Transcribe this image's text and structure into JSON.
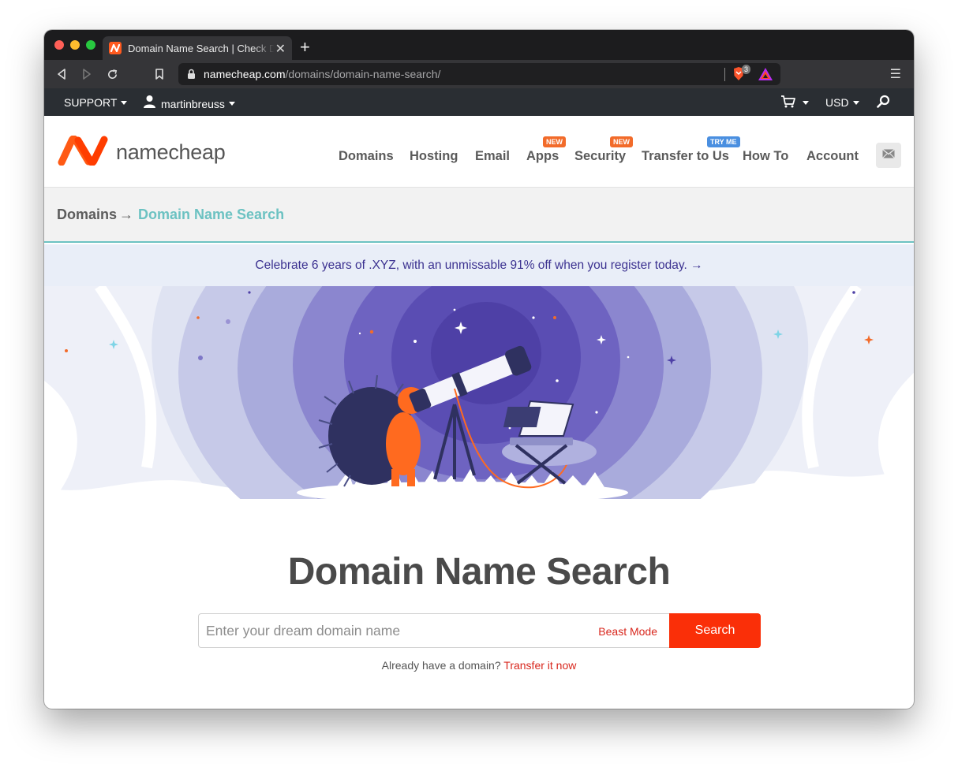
{
  "browser": {
    "tab_title": "Domain Name Search | Check Domain Availability",
    "url_host": "namecheap.com",
    "url_path": "/domains/domain-name-search/",
    "brave_badge_count": "3"
  },
  "sitebar": {
    "support_label": "SUPPORT",
    "username": "martinbreuss",
    "currency": "USD"
  },
  "header": {
    "logo_text": "namecheap",
    "nav": [
      {
        "label": "Domains"
      },
      {
        "label": "Hosting"
      },
      {
        "label": "Email"
      },
      {
        "label": "Apps",
        "badge": "NEW"
      },
      {
        "label": "Security",
        "badge": "NEW"
      },
      {
        "label": "Transfer to Us",
        "badge": "TRY ME"
      },
      {
        "label": "How To"
      },
      {
        "label": "Account"
      }
    ]
  },
  "breadcrumb": {
    "root": "Domains",
    "arrow": "→",
    "current": "Domain Name Search"
  },
  "promo": {
    "text": "Celebrate 6 years of .XYZ, with an unmissable 91% off when you register today. →"
  },
  "main": {
    "heading": "Domain Name Search",
    "search_placeholder": "Enter your dream domain name",
    "beast_mode": "Beast Mode",
    "search_button": "Search",
    "transfer_prompt": "Already have a domain?",
    "transfer_link": "Transfer it now"
  },
  "colors": {
    "brand_orange": "#fa2f08",
    "teal": "#6cc2c2",
    "promo_text": "#3b3190",
    "badge_new": "#f26b2a",
    "badge_try": "#4a8fe0"
  }
}
